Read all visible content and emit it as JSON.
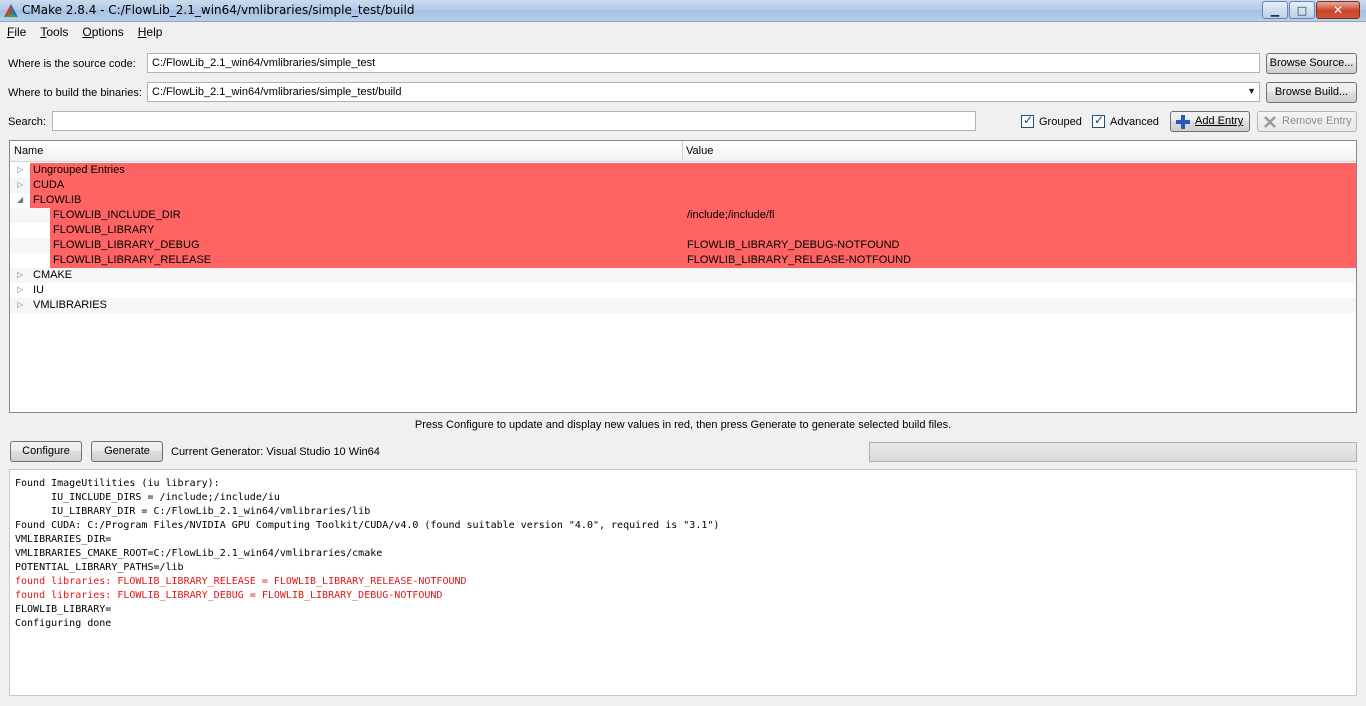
{
  "window": {
    "title": "CMake 2.8.4 - C:/FlowLib_2.1_win64/vmlibraries/simple_test/build",
    "minimize": "▁",
    "maximize": "□",
    "close": "✕"
  },
  "menu": [
    {
      "label": "File",
      "underline": "F",
      "rest": "ile"
    },
    {
      "label": "Tools",
      "underline": "T",
      "rest": "ools"
    },
    {
      "label": "Options",
      "underline": "O",
      "rest": "ptions"
    },
    {
      "label": "Help",
      "underline": "H",
      "rest": "elp"
    }
  ],
  "source": {
    "label": "Where is the source code:",
    "value": "C:/FlowLib_2.1_win64/vmlibraries/simple_test",
    "browse": "Browse Source..."
  },
  "build": {
    "label": "Where to build the binaries:",
    "value": "C:/FlowLib_2.1_win64/vmlibraries/simple_test/build",
    "browse": "Browse Build..."
  },
  "search": {
    "label": "Search:",
    "value": ""
  },
  "options": {
    "grouped": "Grouped",
    "advanced": "Advanced",
    "add_entry": "Add Entry",
    "remove_entry": "Remove Entry"
  },
  "tree": {
    "col_name": "Name",
    "col_value": "Value",
    "rows": [
      {
        "name": "Ungrouped Entries",
        "value": "",
        "level": 0,
        "expander": "▷",
        "red": true
      },
      {
        "name": "CUDA",
        "value": "",
        "level": 0,
        "expander": "▷",
        "red": true
      },
      {
        "name": "FLOWLIB",
        "value": "",
        "level": 0,
        "expander": "◢",
        "red": true
      },
      {
        "name": "FLOWLIB_INCLUDE_DIR",
        "value": "/include;/include/fl",
        "level": 1,
        "expander": "",
        "red": true
      },
      {
        "name": "FLOWLIB_LIBRARY",
        "value": "",
        "level": 1,
        "expander": "",
        "red": true
      },
      {
        "name": "FLOWLIB_LIBRARY_DEBUG",
        "value": "FLOWLIB_LIBRARY_DEBUG-NOTFOUND",
        "level": 1,
        "expander": "",
        "red": true
      },
      {
        "name": "FLOWLIB_LIBRARY_RELEASE",
        "value": "FLOWLIB_LIBRARY_RELEASE-NOTFOUND",
        "level": 1,
        "expander": "",
        "red": true
      },
      {
        "name": "CMAKE",
        "value": "",
        "level": 0,
        "expander": "▷",
        "red": false
      },
      {
        "name": "IU",
        "value": "",
        "level": 0,
        "expander": "▷",
        "red": false
      },
      {
        "name": "VMLIBRARIES",
        "value": "",
        "level": 0,
        "expander": "▷",
        "red": false
      }
    ],
    "red_color": "#ff6464"
  },
  "info": "Press Configure to update and display new values in red, then press Generate to generate selected build files.",
  "actions": {
    "configure": "Configure",
    "generate": "Generate",
    "generator": "Current Generator: Visual Studio 10 Win64"
  },
  "log": [
    {
      "text": "Found ImageUtilities (iu library):",
      "error": false
    },
    {
      "text": "      IU_INCLUDE_DIRS = /include;/include/iu",
      "error": false
    },
    {
      "text": "      IU_LIBRARY_DIR = C:/FlowLib_2.1_win64/vmlibraries/lib",
      "error": false
    },
    {
      "text": "Found CUDA: C:/Program Files/NVIDIA GPU Computing Toolkit/CUDA/v4.0 (found suitable version \"4.0\", required is \"3.1\")",
      "error": false
    },
    {
      "text": "VMLIBRARIES_DIR=",
      "error": false
    },
    {
      "text": "VMLIBRARIES_CMAKE_ROOT=C:/FlowLib_2.1_win64/vmlibraries/cmake",
      "error": false
    },
    {
      "text": "POTENTIAL_LIBRARY_PATHS=/lib",
      "error": false
    },
    {
      "text": "found libraries: FLOWLIB_LIBRARY_RELEASE = FLOWLIB_LIBRARY_RELEASE-NOTFOUND",
      "error": true
    },
    {
      "text": "found libraries: FLOWLIB_LIBRARY_DEBUG = FLOWLIB_LIBRARY_DEBUG-NOTFOUND",
      "error": true
    },
    {
      "text": "FLOWLIB_LIBRARY=",
      "error": false
    },
    {
      "text": "Configuring done",
      "error": false
    }
  ],
  "colors": {
    "error_text": "#e01818",
    "highlight": "#ff6464"
  }
}
